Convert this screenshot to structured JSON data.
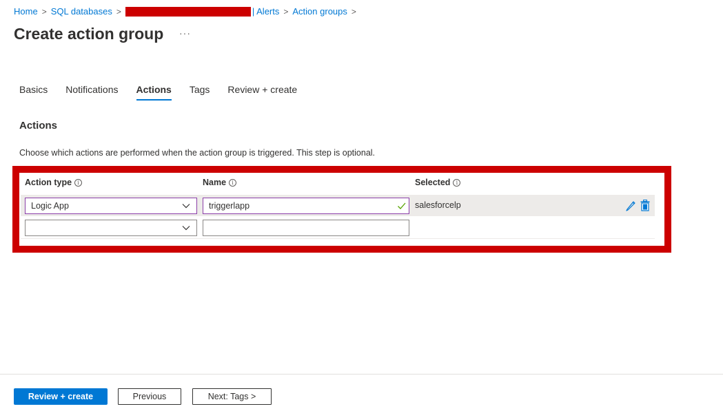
{
  "breadcrumb": {
    "items": [
      "Home",
      "SQL databases",
      "| Alerts",
      "Action groups"
    ],
    "redacted": true
  },
  "header": {
    "title": "Create action group",
    "more_label": "···"
  },
  "tabs": [
    {
      "label": "Basics",
      "active": false
    },
    {
      "label": "Notifications",
      "active": false
    },
    {
      "label": "Actions",
      "active": true
    },
    {
      "label": "Tags",
      "active": false
    },
    {
      "label": "Review + create",
      "active": false
    }
  ],
  "actions_section": {
    "title": "Actions",
    "description": "Choose which actions are performed when the action group is triggered. This step is optional.",
    "columns": {
      "action_type": "Action type",
      "name": "Name",
      "selected": "Selected"
    },
    "info_glyph": "i",
    "rows": [
      {
        "action_type": "Logic App",
        "name": "triggerlapp",
        "selected": "salesforcelp",
        "valid": true
      },
      {
        "action_type": "",
        "name": "",
        "selected": ""
      }
    ]
  },
  "icons": {
    "chevron": "chevron-down-icon",
    "check": "checkmark-icon",
    "edit": "pencil-icon",
    "delete": "trash-icon",
    "info": "info-icon"
  },
  "colors": {
    "accent": "#0078d4",
    "highlight": "#cc0000",
    "valid_check": "#57a300",
    "input_focus_border": "#8a3da8"
  },
  "footer": {
    "review_create": "Review + create",
    "previous": "Previous",
    "next": "Next: Tags >"
  }
}
